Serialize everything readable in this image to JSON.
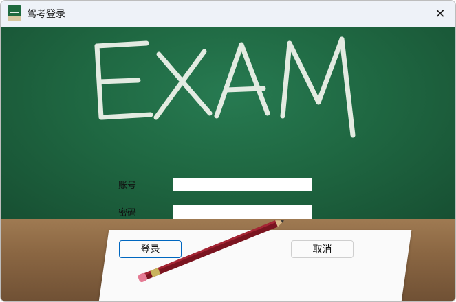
{
  "window": {
    "title": "驾考登录",
    "close_glyph": "✕"
  },
  "hero": {
    "text": "EXAM"
  },
  "form": {
    "account_label": "账号",
    "password_label": "密码",
    "account_value": "",
    "password_value": ""
  },
  "buttons": {
    "login": "登录",
    "cancel": "取消"
  },
  "icons": {
    "app": "chalkboard-icon",
    "close": "close-icon"
  },
  "colors": {
    "board": "#1f6842",
    "chalk": "#f2f4ee",
    "accent": "#0067c0"
  }
}
